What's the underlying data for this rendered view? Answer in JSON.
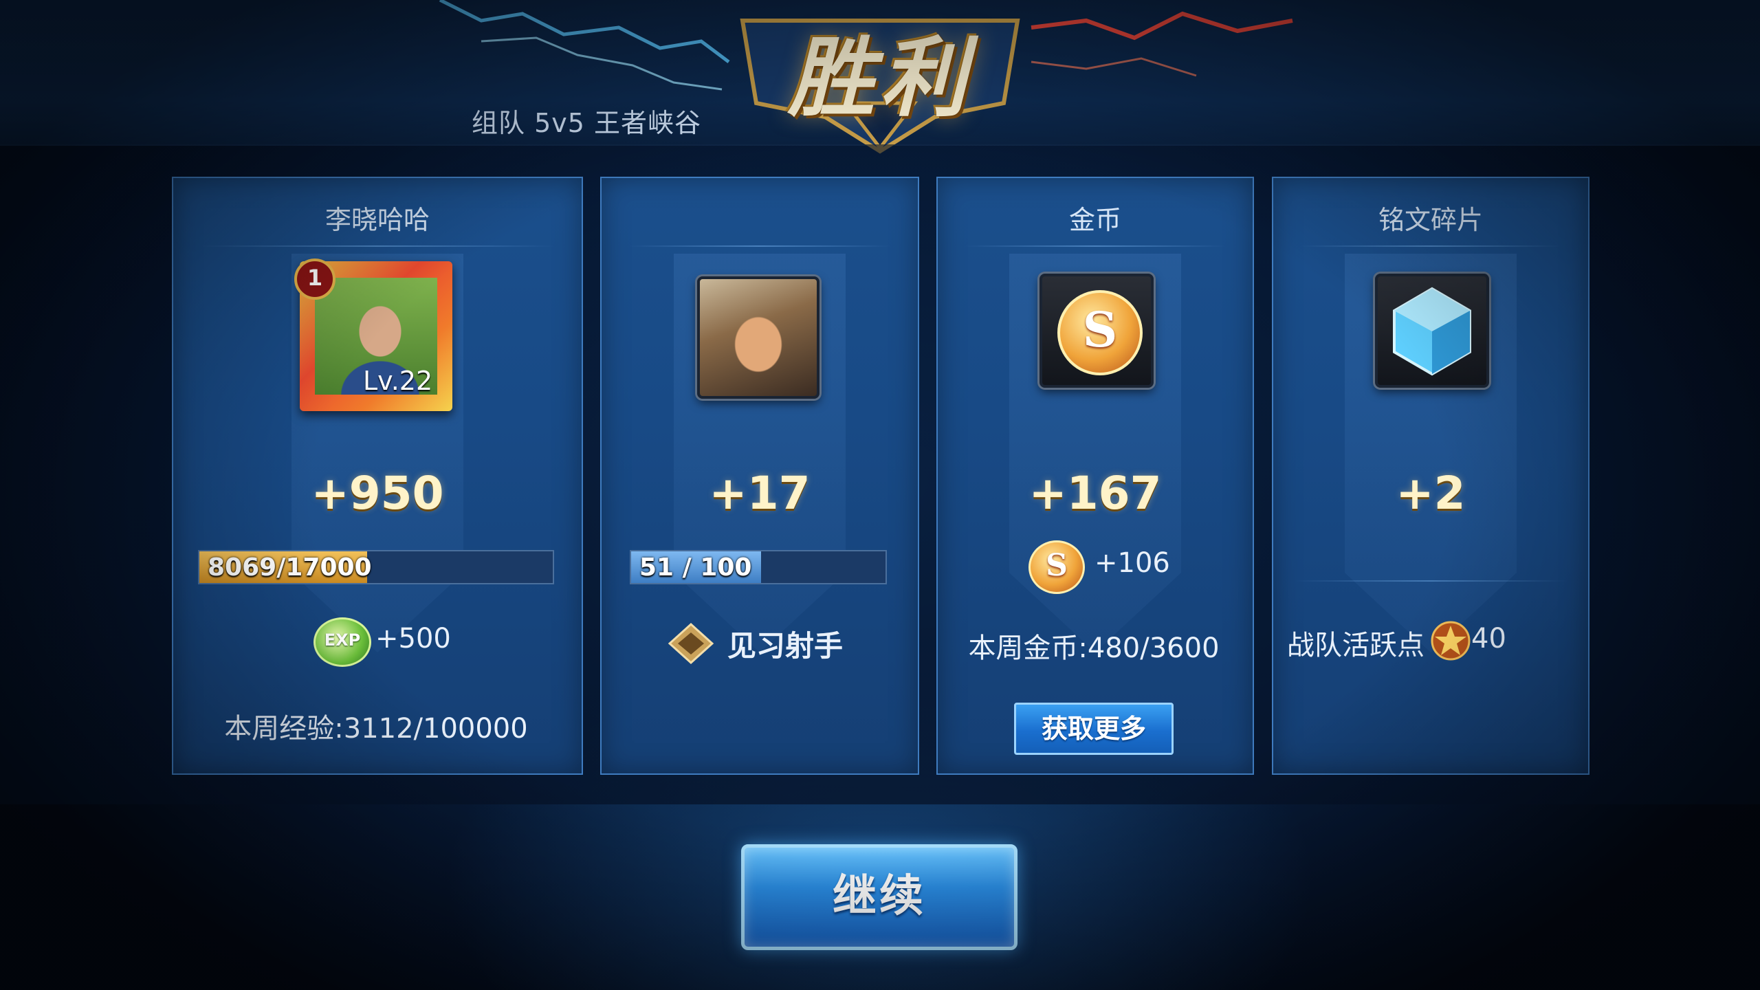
{
  "header": {
    "mode_label": "组队 5v5 王者峡谷",
    "result_title": "胜利"
  },
  "cards": {
    "player": {
      "title": "李晓哈哈",
      "rank_badge": "1",
      "level": "Lv.22",
      "gain": "+950",
      "exp_bar_text": "8069/17000",
      "exp_progress": 0.4746,
      "bonus_icon": "exp-icon",
      "bonus_text": "+500",
      "weekly_text": "本周经验:3112/100000"
    },
    "hero": {
      "title": "",
      "gain": "+17",
      "proficiency_bar_text": "51 / 100",
      "proficiency_progress": 0.51,
      "rank_icon": "rank-diamond-icon",
      "rank_text": "见习射手"
    },
    "gold": {
      "title": "金币",
      "gain": "+167",
      "bonus_icon": "gold-coin-icon",
      "bonus_text": "+106",
      "weekly_text": "本周金币:480/3600",
      "more_button": "获取更多"
    },
    "inscription": {
      "title": "铭文碎片",
      "gain": "+2",
      "team_text": "战队活跃点",
      "team_icon": "star-icon",
      "team_value": "40"
    }
  },
  "continue_button": "继续",
  "colors": {
    "card_bg": "#1b4f8c",
    "gain_gold": "#fff3c9",
    "button_blue": "#2b8fe6",
    "exp_fill": "#e0a53a"
  }
}
